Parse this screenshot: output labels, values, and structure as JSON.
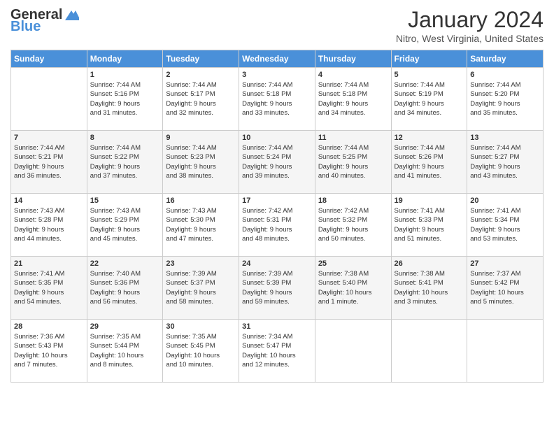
{
  "header": {
    "logo_general": "General",
    "logo_blue": "Blue",
    "month_title": "January 2024",
    "location": "Nitro, West Virginia, United States"
  },
  "calendar": {
    "days_of_week": [
      "Sunday",
      "Monday",
      "Tuesday",
      "Wednesday",
      "Thursday",
      "Friday",
      "Saturday"
    ],
    "weeks": [
      [
        {
          "day": "",
          "info": ""
        },
        {
          "day": "1",
          "info": "Sunrise: 7:44 AM\nSunset: 5:16 PM\nDaylight: 9 hours\nand 31 minutes."
        },
        {
          "day": "2",
          "info": "Sunrise: 7:44 AM\nSunset: 5:17 PM\nDaylight: 9 hours\nand 32 minutes."
        },
        {
          "day": "3",
          "info": "Sunrise: 7:44 AM\nSunset: 5:18 PM\nDaylight: 9 hours\nand 33 minutes."
        },
        {
          "day": "4",
          "info": "Sunrise: 7:44 AM\nSunset: 5:18 PM\nDaylight: 9 hours\nand 34 minutes."
        },
        {
          "day": "5",
          "info": "Sunrise: 7:44 AM\nSunset: 5:19 PM\nDaylight: 9 hours\nand 34 minutes."
        },
        {
          "day": "6",
          "info": "Sunrise: 7:44 AM\nSunset: 5:20 PM\nDaylight: 9 hours\nand 35 minutes."
        }
      ],
      [
        {
          "day": "7",
          "info": "Sunrise: 7:44 AM\nSunset: 5:21 PM\nDaylight: 9 hours\nand 36 minutes."
        },
        {
          "day": "8",
          "info": "Sunrise: 7:44 AM\nSunset: 5:22 PM\nDaylight: 9 hours\nand 37 minutes."
        },
        {
          "day": "9",
          "info": "Sunrise: 7:44 AM\nSunset: 5:23 PM\nDaylight: 9 hours\nand 38 minutes."
        },
        {
          "day": "10",
          "info": "Sunrise: 7:44 AM\nSunset: 5:24 PM\nDaylight: 9 hours\nand 39 minutes."
        },
        {
          "day": "11",
          "info": "Sunrise: 7:44 AM\nSunset: 5:25 PM\nDaylight: 9 hours\nand 40 minutes."
        },
        {
          "day": "12",
          "info": "Sunrise: 7:44 AM\nSunset: 5:26 PM\nDaylight: 9 hours\nand 41 minutes."
        },
        {
          "day": "13",
          "info": "Sunrise: 7:44 AM\nSunset: 5:27 PM\nDaylight: 9 hours\nand 43 minutes."
        }
      ],
      [
        {
          "day": "14",
          "info": "Sunrise: 7:43 AM\nSunset: 5:28 PM\nDaylight: 9 hours\nand 44 minutes."
        },
        {
          "day": "15",
          "info": "Sunrise: 7:43 AM\nSunset: 5:29 PM\nDaylight: 9 hours\nand 45 minutes."
        },
        {
          "day": "16",
          "info": "Sunrise: 7:43 AM\nSunset: 5:30 PM\nDaylight: 9 hours\nand 47 minutes."
        },
        {
          "day": "17",
          "info": "Sunrise: 7:42 AM\nSunset: 5:31 PM\nDaylight: 9 hours\nand 48 minutes."
        },
        {
          "day": "18",
          "info": "Sunrise: 7:42 AM\nSunset: 5:32 PM\nDaylight: 9 hours\nand 50 minutes."
        },
        {
          "day": "19",
          "info": "Sunrise: 7:41 AM\nSunset: 5:33 PM\nDaylight: 9 hours\nand 51 minutes."
        },
        {
          "day": "20",
          "info": "Sunrise: 7:41 AM\nSunset: 5:34 PM\nDaylight: 9 hours\nand 53 minutes."
        }
      ],
      [
        {
          "day": "21",
          "info": "Sunrise: 7:41 AM\nSunset: 5:35 PM\nDaylight: 9 hours\nand 54 minutes."
        },
        {
          "day": "22",
          "info": "Sunrise: 7:40 AM\nSunset: 5:36 PM\nDaylight: 9 hours\nand 56 minutes."
        },
        {
          "day": "23",
          "info": "Sunrise: 7:39 AM\nSunset: 5:37 PM\nDaylight: 9 hours\nand 58 minutes."
        },
        {
          "day": "24",
          "info": "Sunrise: 7:39 AM\nSunset: 5:39 PM\nDaylight: 9 hours\nand 59 minutes."
        },
        {
          "day": "25",
          "info": "Sunrise: 7:38 AM\nSunset: 5:40 PM\nDaylight: 10 hours\nand 1 minute."
        },
        {
          "day": "26",
          "info": "Sunrise: 7:38 AM\nSunset: 5:41 PM\nDaylight: 10 hours\nand 3 minutes."
        },
        {
          "day": "27",
          "info": "Sunrise: 7:37 AM\nSunset: 5:42 PM\nDaylight: 10 hours\nand 5 minutes."
        }
      ],
      [
        {
          "day": "28",
          "info": "Sunrise: 7:36 AM\nSunset: 5:43 PM\nDaylight: 10 hours\nand 7 minutes."
        },
        {
          "day": "29",
          "info": "Sunrise: 7:35 AM\nSunset: 5:44 PM\nDaylight: 10 hours\nand 8 minutes."
        },
        {
          "day": "30",
          "info": "Sunrise: 7:35 AM\nSunset: 5:45 PM\nDaylight: 10 hours\nand 10 minutes."
        },
        {
          "day": "31",
          "info": "Sunrise: 7:34 AM\nSunset: 5:47 PM\nDaylight: 10 hours\nand 12 minutes."
        },
        {
          "day": "",
          "info": ""
        },
        {
          "day": "",
          "info": ""
        },
        {
          "day": "",
          "info": ""
        }
      ]
    ]
  }
}
